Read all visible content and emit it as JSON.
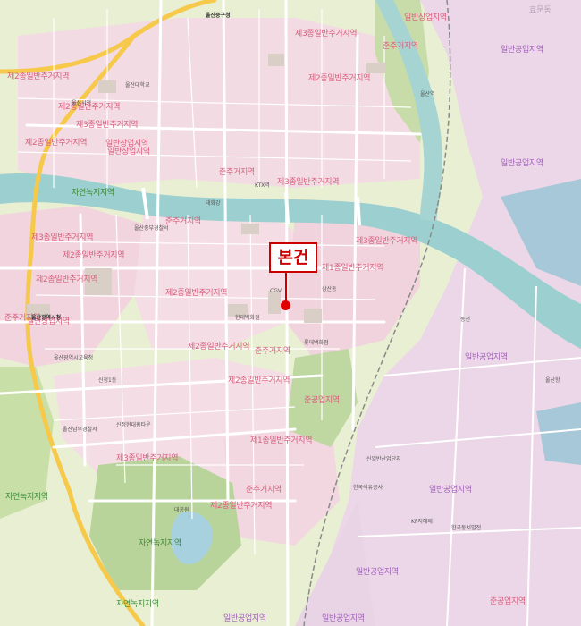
{
  "subject_label": "본건",
  "corner_label": "효문동",
  "zones": [
    {
      "text": "일반상업지역",
      "kind": "pink"
    },
    {
      "text": "준주거지역",
      "kind": "pink"
    },
    {
      "text": "제3종일반주거지역",
      "kind": "pink"
    },
    {
      "text": "제2종일반주거지역",
      "kind": "pink"
    },
    {
      "text": "제2종일반주거지역",
      "kind": "pink"
    },
    {
      "text": "제2종일반주거지역",
      "kind": "pink"
    },
    {
      "text": "제3종일반주거지역",
      "kind": "pink"
    },
    {
      "text": "일반상업지역",
      "kind": "pink"
    },
    {
      "text": "제2종일반주거지역",
      "kind": "pink"
    },
    {
      "text": "제3종일반주거지역",
      "kind": "pink"
    },
    {
      "text": "준주거지역",
      "kind": "pink"
    },
    {
      "text": "자연녹지지역",
      "kind": "green"
    },
    {
      "text": "준주거지역",
      "kind": "pink"
    },
    {
      "text": "제3종일반주거지역",
      "kind": "pink"
    },
    {
      "text": "제2종일반주거지역",
      "kind": "pink"
    },
    {
      "text": "제2종일반주거지역",
      "kind": "pink"
    },
    {
      "text": "제2종일반주거지역",
      "kind": "pink"
    },
    {
      "text": "일반상업지역",
      "kind": "pink"
    },
    {
      "text": "준주거지역",
      "kind": "pink"
    },
    {
      "text": "제2종일반주거지역",
      "kind": "pink"
    },
    {
      "text": "제2종일반주거지역",
      "kind": "pink"
    },
    {
      "text": "제3종일반주거지역",
      "kind": "pink"
    },
    {
      "text": "준주거지역",
      "kind": "pink"
    },
    {
      "text": "제1종일반주거지역",
      "kind": "pink"
    },
    {
      "text": "일반공업지역",
      "kind": "purple"
    },
    {
      "text": "준공업지역",
      "kind": "pink"
    },
    {
      "text": "제1종일반주거지역",
      "kind": "pink"
    },
    {
      "text": "제3종일반주거지역",
      "kind": "pink"
    },
    {
      "text": "준주거지역",
      "kind": "pink"
    },
    {
      "text": "제2종일반주거지역",
      "kind": "pink"
    },
    {
      "text": "자연녹지지역",
      "kind": "green"
    },
    {
      "text": "자연녹지지역",
      "kind": "green"
    },
    {
      "text": "일반공업지역",
      "kind": "purple"
    },
    {
      "text": "일반공업지역",
      "kind": "purple"
    },
    {
      "text": "일반공업지역",
      "kind": "purple"
    },
    {
      "text": "자연녹지지역",
      "kind": "green"
    },
    {
      "text": "일반공업지역",
      "kind": "purple"
    },
    {
      "text": "준공업지역",
      "kind": "pink"
    },
    {
      "text": "일반공업지역",
      "kind": "purple"
    },
    {
      "text": "일반공업지역",
      "kind": "purple"
    },
    {
      "text": "일반상업지역",
      "kind": "pink"
    }
  ],
  "places": [
    "울산중구청",
    "울산광역시청",
    "울산대학교",
    "울산광역시교육청",
    "신정1동",
    "KTX역",
    "현대백화점",
    "롯데백화점",
    "울산중부경찰서",
    "CGV",
    "대공원",
    "삼산동",
    "울산역",
    "울산시청",
    "효문동",
    "울산항",
    "KF저해제",
    "한국석유공사",
    "태화강",
    "동천",
    "신일반산업단지",
    "한국동서발전",
    "울산남부경찰서",
    "신정현대홈타운"
  ]
}
